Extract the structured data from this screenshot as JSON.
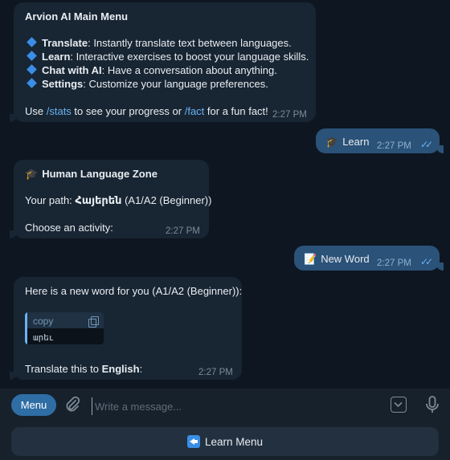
{
  "messages": {
    "main_menu": {
      "title": "Arvion AI Main Menu",
      "items": [
        {
          "name": "Translate",
          "desc": ": Instantly translate text between languages."
        },
        {
          "name": "Learn",
          "desc": ": Interactive exercises to boost your language skills."
        },
        {
          "name": "Chat with AI",
          "desc": ": Have a conversation about anything."
        },
        {
          "name": "Settings",
          "desc": ": Customize your language preferences."
        }
      ],
      "footer_pre": "Use ",
      "footer_cmd1": "/stats",
      "footer_mid": " to see your progress or ",
      "footer_cmd2": "/fact",
      "footer_post": " for a fun fact!",
      "time": "2:27 PM"
    },
    "learn_out": {
      "emoji": "🎓",
      "text": "Learn",
      "time": "2:27 PM"
    },
    "zone": {
      "emoji": "🎓",
      "title": "Human Language Zone",
      "path_label": "Your path: ",
      "path_lang": "Հայերեն",
      "path_level": " (A1/A2 (Beginner))",
      "prompt": "Choose an activity:",
      "time": "2:27 PM"
    },
    "new_word_out": {
      "emoji": "📝",
      "text": "New Word",
      "time": "2:27 PM"
    },
    "word": {
      "intro": "Here is a new word for you (A1/A2 (Beginner)):",
      "copy_label": "copy",
      "code": "արեւ",
      "translate_pre": "Translate this to ",
      "translate_lang": "English",
      "translate_post": ":",
      "time": "2:27 PM"
    }
  },
  "composer": {
    "menu_label": "Menu",
    "placeholder": "Write a message..."
  },
  "keyboard": {
    "button_label": "Learn Menu"
  },
  "colors": {
    "background": "#0e1621",
    "incoming_bubble": "#182533",
    "outgoing_bubble": "#2b5278",
    "accent": "#6ab2f2",
    "menu_button": "#2f6ea5"
  }
}
